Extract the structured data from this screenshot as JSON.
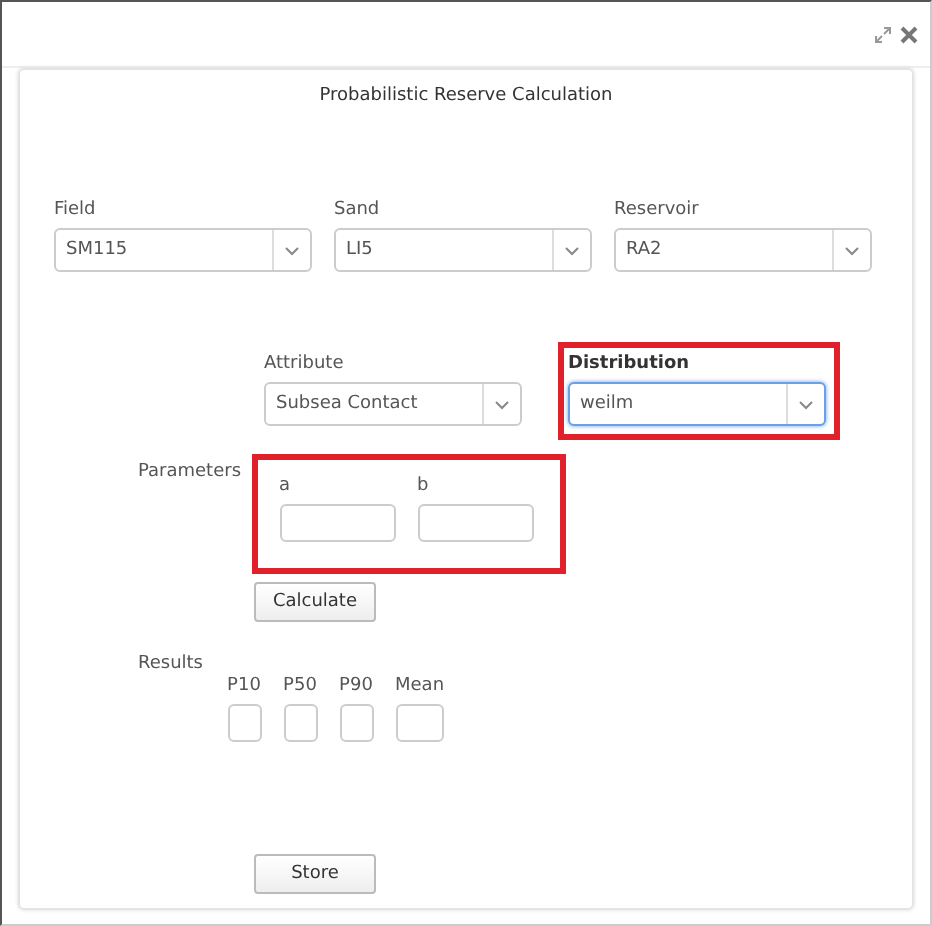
{
  "dialog": {
    "title": "Probabilistic Reserve Calculation"
  },
  "selects": [
    {
      "label": "Field",
      "value": "SM115"
    },
    {
      "label": "Sand",
      "value": "LI5"
    },
    {
      "label": "Reservoir",
      "value": "RA2"
    }
  ],
  "attribute": {
    "label": "Attribute",
    "value": "Subsea Contact",
    "focused": false
  },
  "distribution": {
    "label": "Distribution",
    "value": "weilm",
    "focused": true,
    "highlighted": true
  },
  "parameters": {
    "label": "Parameters",
    "highlighted": true,
    "fields": [
      {
        "label": "a"
      },
      {
        "label": "b"
      }
    ]
  },
  "calculate_button": "Calculate",
  "results": {
    "label": "Results",
    "fields": [
      {
        "label": "P10"
      },
      {
        "label": "P50"
      },
      {
        "label": "P90"
      },
      {
        "label": "Mean"
      }
    ]
  },
  "store_button": "Store"
}
